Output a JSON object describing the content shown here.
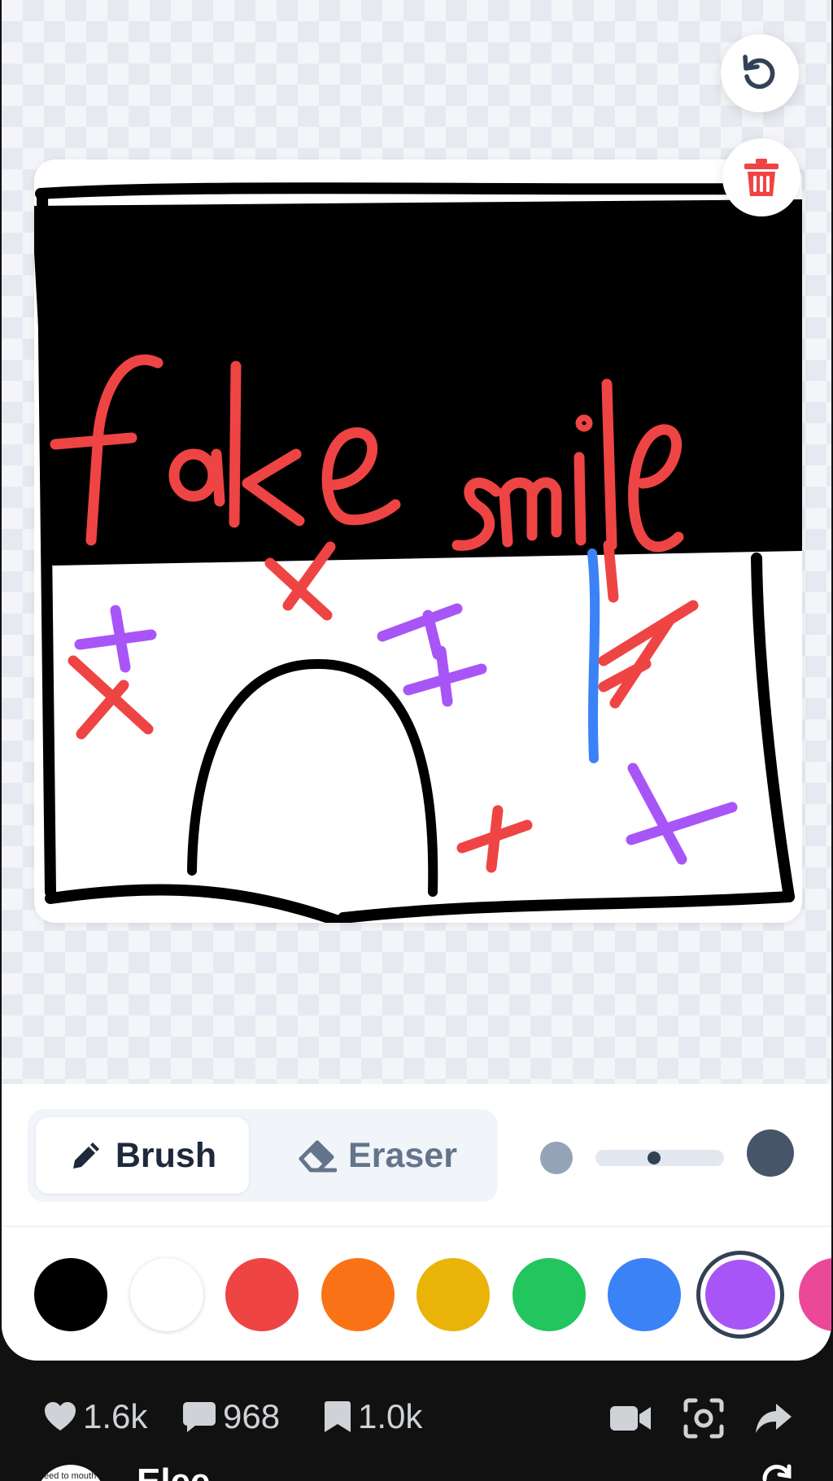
{
  "canvas": {
    "stroke_colors": {
      "black": "#000000",
      "red": "#ef4444",
      "purple": "#a855f7",
      "blue": "#3b82f6"
    },
    "trash_color": "#ef4444"
  },
  "toolbar": {
    "brush_label": "Brush",
    "eraser_label": "Eraser",
    "active_tool": "brush",
    "brush_size_level": 0.45
  },
  "palette": {
    "colors": [
      "#000000",
      "#ffffff",
      "#ef4444",
      "#f97316",
      "#eab308",
      "#22c55e",
      "#3b82f6",
      "#a855f7",
      "#ec4899"
    ],
    "selected": "#a855f7"
  },
  "bottom_bar": {
    "likes": "1.6k",
    "comments": "968",
    "saves": "1.0k",
    "username": "Elee",
    "avatar_text": "eed to mouth"
  },
  "icons": {
    "undo": "undo-icon",
    "clear": "trash-icon",
    "brush": "pencil-icon",
    "eraser": "eraser-icon",
    "likes": "heart-icon",
    "comments": "comment-icon",
    "saves": "bookmark-icon",
    "video": "video-camera-icon",
    "capture": "screenshot-icon",
    "share": "share-arrow-icon",
    "repost": "repost-icon"
  }
}
